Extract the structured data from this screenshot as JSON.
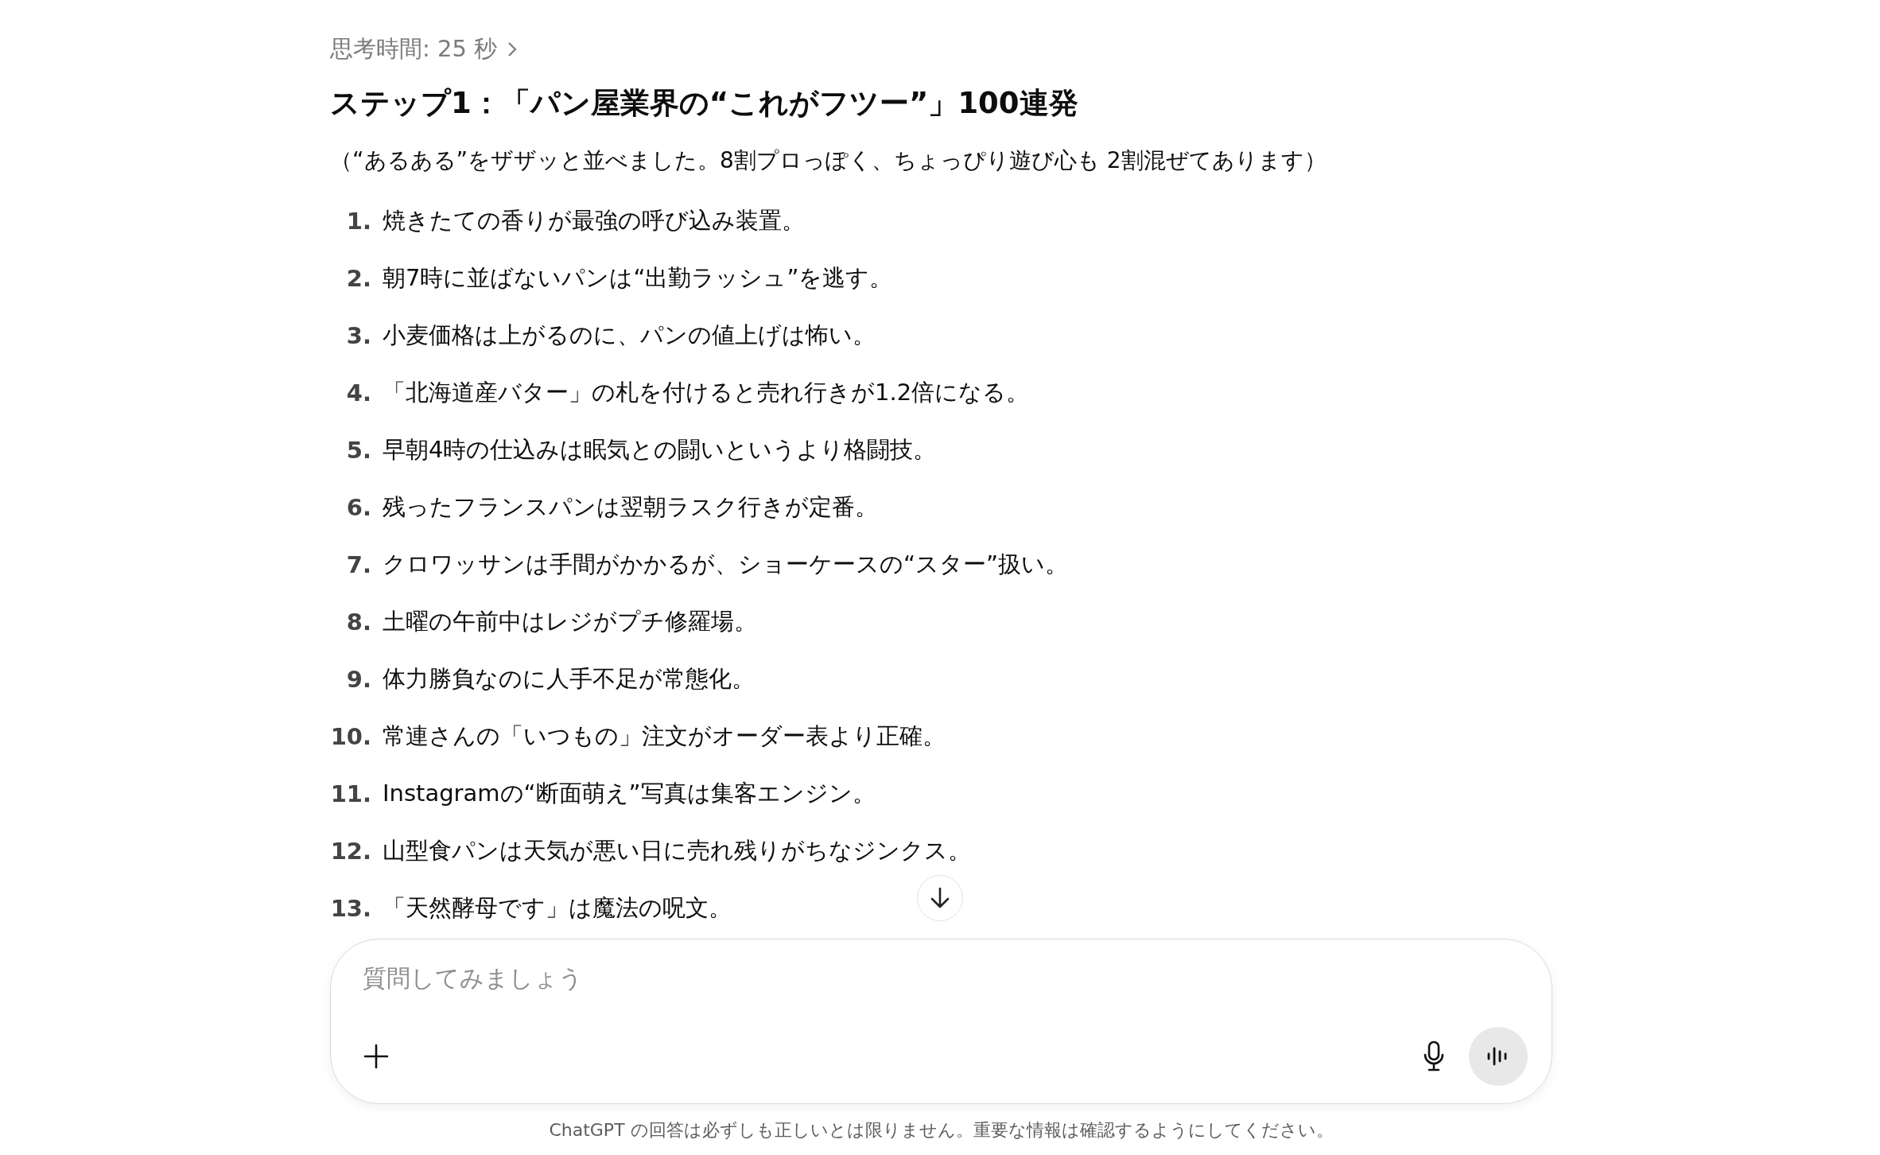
{
  "thinking": {
    "label": "思考時間: 25 秒"
  },
  "heading": "ステップ1：「パン屋業界の“これがフツー”」100連発",
  "intro": "（“あるある”をザザッと並べました。8割プロっぽく、ちょっぴり遊び心も 2割混ぜてあります）",
  "items": [
    {
      "number": "1.",
      "text": "焼きたての香りが最強の呼び込み装置。"
    },
    {
      "number": "2.",
      "text": "朝7時に並ばないパンは“出勤ラッシュ”を逃す。"
    },
    {
      "number": "3.",
      "text": "小麦価格は上がるのに、パンの値上げは怖い。"
    },
    {
      "number": "4.",
      "text": "「北海道産バター」の札を付けると売れ行きが1.2倍になる。"
    },
    {
      "number": "5.",
      "text": "早朝4時の仕込みは眠気との闘いというより格闘技。"
    },
    {
      "number": "6.",
      "text": "残ったフランスパンは翌朝ラスク行きが定番。"
    },
    {
      "number": "7.",
      "text": "クロワッサンは手間がかかるが、ショーケースの“スター”扱い。"
    },
    {
      "number": "8.",
      "text": "土曜の午前中はレジがプチ修羅場。"
    },
    {
      "number": "9.",
      "text": "体力勝負なのに人手不足が常態化。"
    },
    {
      "number": "10.",
      "text": "常連さんの「いつもの」注文がオーダー表より正確。"
    },
    {
      "number": "11.",
      "text": "Instagramの“断面萌え”写真は集客エンジン。"
    },
    {
      "number": "12.",
      "text": "山型食パンは天気が悪い日に売れ残りがちなジンクス。"
    },
    {
      "number": "13.",
      "text": "「天然酵母です」は魔法の呪文。"
    }
  ],
  "composer": {
    "placeholder": "質問してみましょう"
  },
  "disclaimer": "ChatGPT の回答は必ずしも正しいとは限りません。重要な情報は確認するようにしてください。"
}
